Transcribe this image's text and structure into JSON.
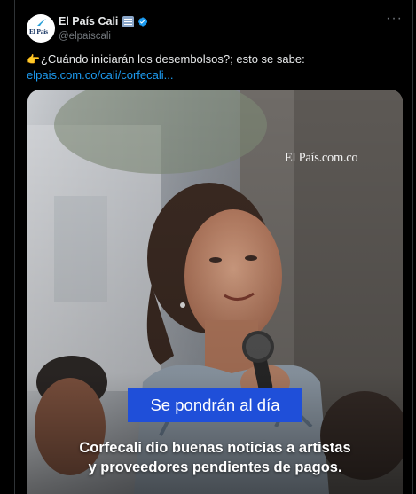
{
  "account": {
    "display_name": "El País Cali",
    "handle": "@elpaiscali",
    "avatar_text": "El País",
    "badge_icon": "news-badge-icon",
    "verified_icon": "verified-badge-icon",
    "more_label": "···"
  },
  "tweet": {
    "emoji": "👉",
    "text": "¿Cuándo iniciarán los desembolsos?; esto se sabe:",
    "link_text": "elpais.com.co/cali/corfecali..."
  },
  "media": {
    "watermark": "El País.com.co",
    "headline": "Se pondrán al día",
    "caption_line1": "Corfecali dio buenas noticias a artistas",
    "caption_line2": "y proveedores pendientes de pagos."
  },
  "colors": {
    "background": "#000000",
    "link": "#1d9bf0",
    "verified": "#1d9bf0",
    "headline_badge": "#1f4fd9",
    "muted_text": "#71767b"
  }
}
